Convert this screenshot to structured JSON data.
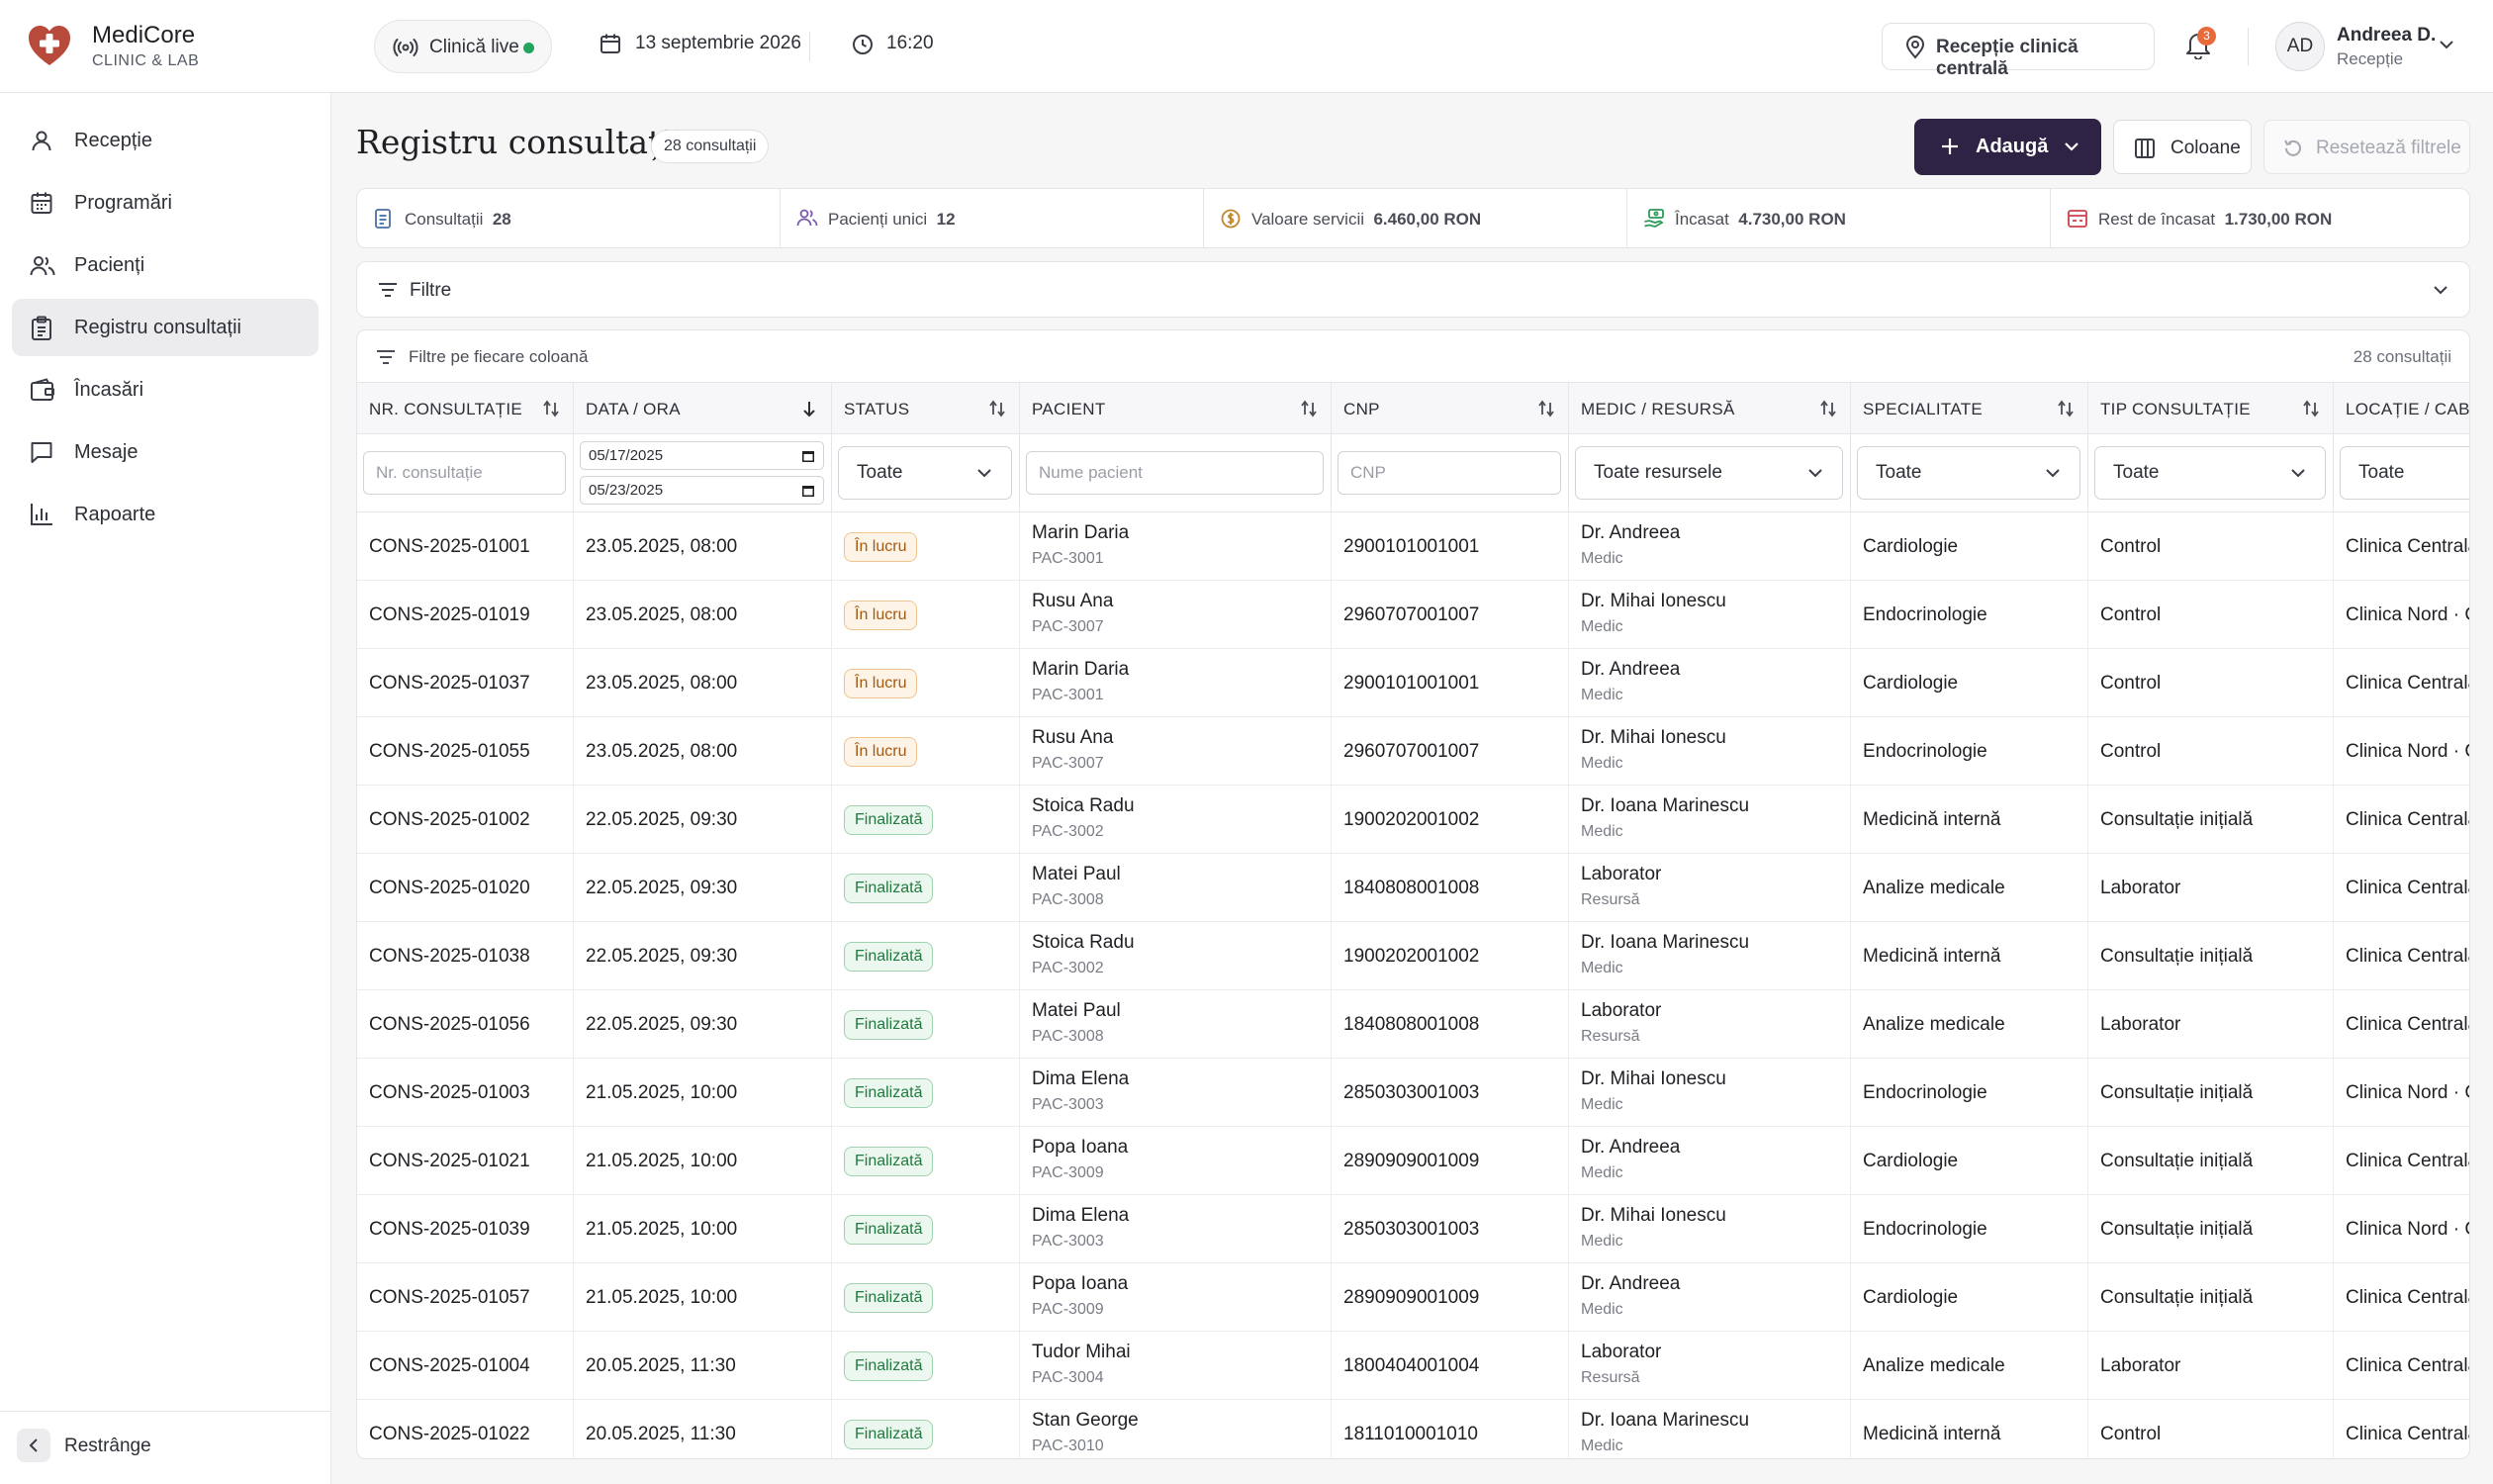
{
  "brand": {
    "name": "MediCore",
    "subtitle": "CLINIC & LAB"
  },
  "header": {
    "live_label": "Clinică live",
    "date": "13 septembrie 2026",
    "time": "16:20",
    "location": "Recepție clinică centrală",
    "notifications_count": "3",
    "user_initials": "AD",
    "user_name": "Andreea D.",
    "user_role": "Recepție"
  },
  "sidebar": {
    "items": [
      {
        "label": "Recepție",
        "icon": "user-icon"
      },
      {
        "label": "Programări",
        "icon": "calendar-icon"
      },
      {
        "label": "Pacienți",
        "icon": "users-icon"
      },
      {
        "label": "Registru consultații",
        "icon": "clipboard-icon",
        "active": true
      },
      {
        "label": "Încasări",
        "icon": "wallet-icon"
      },
      {
        "label": "Mesaje",
        "icon": "message-icon"
      },
      {
        "label": "Rapoarte",
        "icon": "chart-icon"
      }
    ],
    "collapse_label": "Restrânge"
  },
  "page": {
    "title": "Registru consultații",
    "count_badge": "28 consultații",
    "add_label": "Adaugă",
    "columns_label": "Coloane",
    "reset_label": "Resetează filtrele"
  },
  "stats": [
    {
      "label": "Consultații",
      "value": "28"
    },
    {
      "label": "Pacienți unici",
      "value": "12"
    },
    {
      "label": "Valoare servicii",
      "value": "6.460,00 RON"
    },
    {
      "label": "Încasat",
      "value": "4.730,00 RON"
    },
    {
      "label": "Rest de încasat",
      "value": "1.730,00 RON"
    }
  ],
  "filters": {
    "label": "Filtre"
  },
  "table": {
    "column_filters_label": "Filtre pe fiecare coloană",
    "count": "28 consultații",
    "columns": [
      "NR. CONSULTAȚIE",
      "DATA / ORA",
      "STATUS",
      "PACIENT",
      "CNP",
      "MEDIC / RESURSĂ",
      "SPECIALITATE",
      "TIP CONSULTAȚIE",
      "LOCAȚIE / CABINET"
    ],
    "filter_inputs": {
      "nr_placeholder": "Nr. consultație",
      "date_from": "05/17/2025",
      "date_to": "05/23/2025",
      "status_value": "Toate",
      "patient_placeholder": "Nume pacient",
      "cnp_placeholder": "CNP",
      "medic_value": "Toate resursele",
      "specialty_value": "Toate",
      "type_value": "Toate",
      "location_value": "Toate"
    },
    "rows": [
      {
        "nr": "CONS-2025-01001",
        "date": "23.05.2025, 08:00",
        "status": "În lucru",
        "st": "work",
        "patient": "Marin Daria",
        "pid": "PAC-3001",
        "cnp": "2900101001001",
        "medic": "Dr. Andreea",
        "role": "Medic",
        "spec": "Cardiologie",
        "type": "Control",
        "loc": "Clinica Centrală"
      },
      {
        "nr": "CONS-2025-01019",
        "date": "23.05.2025, 08:00",
        "status": "În lucru",
        "st": "work",
        "patient": "Rusu Ana",
        "pid": "PAC-3007",
        "cnp": "2960707001007",
        "medic": "Dr. Mihai Ionescu",
        "role": "Medic",
        "spec": "Endocrinologie",
        "type": "Control",
        "loc": "Clinica Nord · Ca"
      },
      {
        "nr": "CONS-2025-01037",
        "date": "23.05.2025, 08:00",
        "status": "În lucru",
        "st": "work",
        "patient": "Marin Daria",
        "pid": "PAC-3001",
        "cnp": "2900101001001",
        "medic": "Dr. Andreea",
        "role": "Medic",
        "spec": "Cardiologie",
        "type": "Control",
        "loc": "Clinica Centrală"
      },
      {
        "nr": "CONS-2025-01055",
        "date": "23.05.2025, 08:00",
        "status": "În lucru",
        "st": "work",
        "patient": "Rusu Ana",
        "pid": "PAC-3007",
        "cnp": "2960707001007",
        "medic": "Dr. Mihai Ionescu",
        "role": "Medic",
        "spec": "Endocrinologie",
        "type": "Control",
        "loc": "Clinica Nord · Ca"
      },
      {
        "nr": "CONS-2025-01002",
        "date": "22.05.2025, 09:30",
        "status": "Finalizată",
        "st": "done",
        "patient": "Stoica Radu",
        "pid": "PAC-3002",
        "cnp": "1900202001002",
        "medic": "Dr. Ioana Marinescu",
        "role": "Medic",
        "spec": "Medicină internă",
        "type": "Consultație inițială",
        "loc": "Clinica Centrală"
      },
      {
        "nr": "CONS-2025-01020",
        "date": "22.05.2025, 09:30",
        "status": "Finalizată",
        "st": "done",
        "patient": "Matei Paul",
        "pid": "PAC-3008",
        "cnp": "1840808001008",
        "medic": "Laborator",
        "role": "Resursă",
        "spec": "Analize medicale",
        "type": "Laborator",
        "loc": "Clinica Centrală"
      },
      {
        "nr": "CONS-2025-01038",
        "date": "22.05.2025, 09:30",
        "status": "Finalizată",
        "st": "done",
        "patient": "Stoica Radu",
        "pid": "PAC-3002",
        "cnp": "1900202001002",
        "medic": "Dr. Ioana Marinescu",
        "role": "Medic",
        "spec": "Medicină internă",
        "type": "Consultație inițială",
        "loc": "Clinica Centrală"
      },
      {
        "nr": "CONS-2025-01056",
        "date": "22.05.2025, 09:30",
        "status": "Finalizată",
        "st": "done",
        "patient": "Matei Paul",
        "pid": "PAC-3008",
        "cnp": "1840808001008",
        "medic": "Laborator",
        "role": "Resursă",
        "spec": "Analize medicale",
        "type": "Laborator",
        "loc": "Clinica Centrală"
      },
      {
        "nr": "CONS-2025-01003",
        "date": "21.05.2025, 10:00",
        "status": "Finalizată",
        "st": "done",
        "patient": "Dima Elena",
        "pid": "PAC-3003",
        "cnp": "2850303001003",
        "medic": "Dr. Mihai Ionescu",
        "role": "Medic",
        "spec": "Endocrinologie",
        "type": "Consultație inițială",
        "loc": "Clinica Nord · Ca"
      },
      {
        "nr": "CONS-2025-01021",
        "date": "21.05.2025, 10:00",
        "status": "Finalizată",
        "st": "done",
        "patient": "Popa Ioana",
        "pid": "PAC-3009",
        "cnp": "2890909001009",
        "medic": "Dr. Andreea",
        "role": "Medic",
        "spec": "Cardiologie",
        "type": "Consultație inițială",
        "loc": "Clinica Centrală"
      },
      {
        "nr": "CONS-2025-01039",
        "date": "21.05.2025, 10:00",
        "status": "Finalizată",
        "st": "done",
        "patient": "Dima Elena",
        "pid": "PAC-3003",
        "cnp": "2850303001003",
        "medic": "Dr. Mihai Ionescu",
        "role": "Medic",
        "spec": "Endocrinologie",
        "type": "Consultație inițială",
        "loc": "Clinica Nord · Ca"
      },
      {
        "nr": "CONS-2025-01057",
        "date": "21.05.2025, 10:00",
        "status": "Finalizată",
        "st": "done",
        "patient": "Popa Ioana",
        "pid": "PAC-3009",
        "cnp": "2890909001009",
        "medic": "Dr. Andreea",
        "role": "Medic",
        "spec": "Cardiologie",
        "type": "Consultație inițială",
        "loc": "Clinica Centrală"
      },
      {
        "nr": "CONS-2025-01004",
        "date": "20.05.2025, 11:30",
        "status": "Finalizată",
        "st": "done",
        "patient": "Tudor Mihai",
        "pid": "PAC-3004",
        "cnp": "1800404001004",
        "medic": "Laborator",
        "role": "Resursă",
        "spec": "Analize medicale",
        "type": "Laborator",
        "loc": "Clinica Centrală"
      },
      {
        "nr": "CONS-2025-01022",
        "date": "20.05.2025, 11:30",
        "status": "Finalizată",
        "st": "done",
        "patient": "Stan George",
        "pid": "PAC-3010",
        "cnp": "1811010001010",
        "medic": "Dr. Ioana Marinescu",
        "role": "Medic",
        "spec": "Medicină internă",
        "type": "Control",
        "loc": "Clinica Centrală"
      }
    ]
  }
}
